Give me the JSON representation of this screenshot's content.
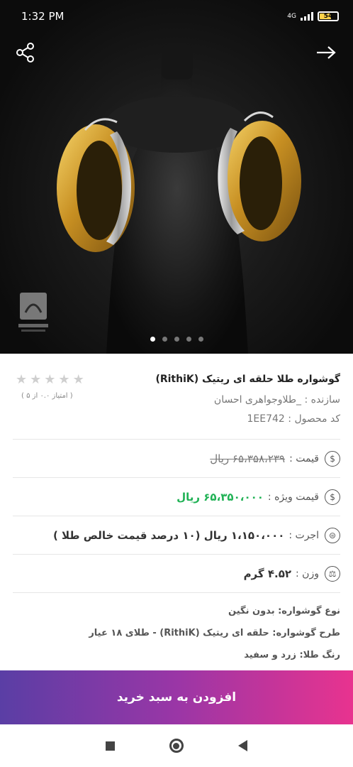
{
  "status": {
    "time": "1:32 PM",
    "network": "4G",
    "battery": "54"
  },
  "gallery": {
    "image_count": 5,
    "active_index": 0,
    "watermark_text": "طلا و جواهر"
  },
  "product": {
    "title": "گوشواره طلا حلقه ای ریتیک (RithiK)",
    "maker": "سازنده : _طلاوجواهری احسان",
    "code": "کد محصول : 1EE742",
    "rating_text": "( امتیاز ۰.۰ از ۵ )",
    "stars": 0
  },
  "pricing": {
    "price_label": "قیمت :",
    "price_value": "۶۵،۳۵۸،۲۳۹ ریال",
    "special_label": "قیمت ویژه :",
    "special_value": "۶۵،۳۵۰،۰۰۰ ریال",
    "wage_label": "اجرت :",
    "wage_value": "۱،۱۵۰،۰۰۰ ریال (۱۰ درصد قیمت خالص طلا )",
    "weight_label": "وزن :",
    "weight_value": "۴.۵۲ گرم"
  },
  "details": [
    "نوع گوشواره: بدون نگین",
    "طرح گوشواره: حلقه ای ریتیک (RithiK) - طلای ۱۸ عیار",
    "رنگ طلا: زرد و سفید"
  ],
  "cta": {
    "label": "افزودن به سبد خرید"
  },
  "colors": {
    "special_price": "#20b255",
    "cta_start": "#5a3ea5",
    "cta_end": "#e8338f"
  }
}
